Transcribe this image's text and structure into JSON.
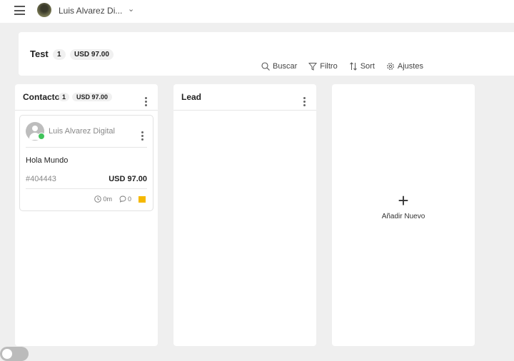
{
  "topbar": {
    "account": "Luis Alvarez Di...",
    "menu_icon": "hamburger-icon",
    "dropdown_icon": "chevron-down-icon"
  },
  "header": {
    "title": "Test",
    "count": "1",
    "amount": "USD 97.00",
    "tools": [
      {
        "label": "Buscar",
        "icon": "search-icon"
      },
      {
        "label": "Filtro",
        "icon": "filter-icon"
      },
      {
        "label": "Sort",
        "icon": "sort-icon"
      },
      {
        "label": "Ajustes",
        "icon": "gear-icon"
      }
    ]
  },
  "columns": [
    {
      "title": "Contacto",
      "count": "1",
      "amount": "USD 97.00",
      "cards": [
        {
          "contact": "Luis Alvarez Digital",
          "message": "Hola Mundo",
          "id": "#404443",
          "amount": "USD 97.00",
          "time": "0m",
          "comments": "0",
          "flag_color": "#f5b800",
          "channel_icon": "whatsapp-icon"
        }
      ]
    },
    {
      "title": "Lead"
    }
  ],
  "add_column": {
    "label": "Añadir Nuevo",
    "icon": "plus-icon"
  },
  "colors": {
    "background": "#efefef",
    "flag": "#f5b800",
    "whatsapp": "#3fc35a"
  }
}
